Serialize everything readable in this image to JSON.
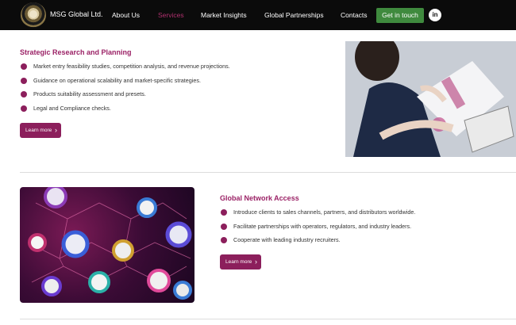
{
  "nav": {
    "brand": "MSG Global Ltd.",
    "links": [
      {
        "label": "About Us",
        "active": false
      },
      {
        "label": "Services",
        "active": true
      },
      {
        "label": "Market Insights",
        "active": false
      },
      {
        "label": "Global Partnerships",
        "active": false
      },
      {
        "label": "Contacts",
        "active": false
      }
    ],
    "cta_label": "Get in touch",
    "social_label": "in"
  },
  "sections": [
    {
      "title": "Strategic Research and Planning",
      "bullets": [
        "Market entry feasibility studies, competition analysis, and revenue projections.",
        "Guidance on operational scalability and market-specific strategies.",
        "Products suitability assessment and presets.",
        "Legal and Compliance checks."
      ],
      "button_label": "Learn more"
    },
    {
      "title": "Global Network Access",
      "bullets": [
        "Introduce clients to sales channels, partners, and distributors worldwide.",
        "Facilitate partnerships with operators, regulators, and industry leaders.",
        "Cooperate with leading industry recruiters."
      ],
      "button_label": "Learn more"
    }
  ],
  "colors": {
    "accent": "#8c1f5c",
    "title": "#9b2266",
    "nav_bg": "#0b0b0b",
    "cta_bg": "#3f8a3e",
    "nav_active": "#b0306e"
  },
  "icons": {
    "logo": "msg-logo-emblem",
    "social": "linkedin-icon",
    "button": "chevron-right-icon",
    "bullet": "bullet-dot"
  }
}
